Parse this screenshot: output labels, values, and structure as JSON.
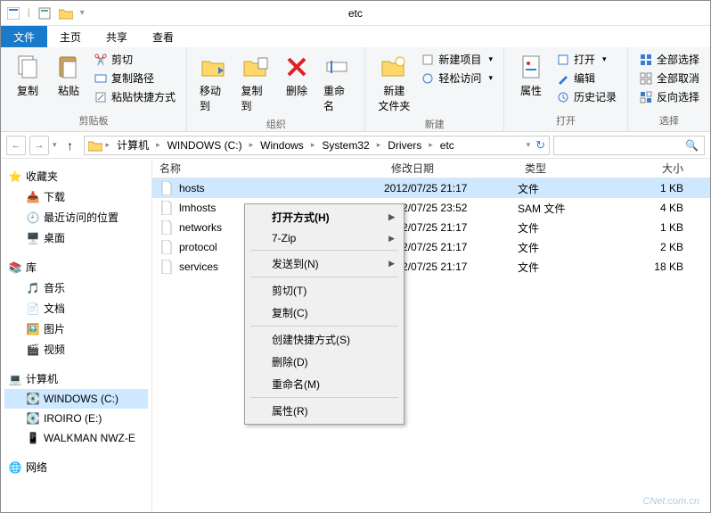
{
  "window": {
    "title": "etc"
  },
  "tabs": [
    {
      "label": "文件",
      "active": true
    },
    {
      "label": "主页",
      "active": false
    },
    {
      "label": "共享",
      "active": false
    },
    {
      "label": "查看",
      "active": false
    }
  ],
  "ribbon": {
    "clipboard": {
      "label": "剪贴板",
      "copy": "复制",
      "paste": "粘贴",
      "cut": "剪切",
      "copy_path": "复制路径",
      "paste_shortcut": "粘贴快捷方式"
    },
    "organize": {
      "label": "组织",
      "move_to": "移动到",
      "copy_to": "复制到",
      "delete": "删除",
      "rename": "重命名"
    },
    "new": {
      "label": "新建",
      "new_folder": "新建\n文件夹",
      "new_item": "新建项目",
      "easy_access": "轻松访问"
    },
    "open": {
      "label": "打开",
      "properties": "属性",
      "open": "打开",
      "edit": "编辑",
      "history": "历史记录"
    },
    "select": {
      "label": "选择",
      "select_all": "全部选择",
      "select_none": "全部取消",
      "invert": "反向选择"
    }
  },
  "breadcrumbs": [
    "计算机",
    "WINDOWS (C:)",
    "Windows",
    "System32",
    "Drivers",
    "etc"
  ],
  "columns": {
    "name": "名称",
    "date": "修改日期",
    "type": "类型",
    "size": "大小"
  },
  "files": [
    {
      "name": "hosts",
      "date": "2012/07/25 21:17",
      "type": "文件",
      "size": "1 KB",
      "selected": true
    },
    {
      "name": "lmhosts",
      "date": "2012/07/25 23:52",
      "type": "SAM 文件",
      "size": "4 KB",
      "selected": false
    },
    {
      "name": "networks",
      "date": "2012/07/25 21:17",
      "type": "文件",
      "size": "1 KB",
      "selected": false
    },
    {
      "name": "protocol",
      "date": "2012/07/25 21:17",
      "type": "文件",
      "size": "2 KB",
      "selected": false
    },
    {
      "name": "services",
      "date": "2012/07/25 21:17",
      "type": "文件",
      "size": "18 KB",
      "selected": false
    }
  ],
  "sidebar": {
    "favorites": {
      "label": "收藏夹",
      "items": [
        "下载",
        "最近访问的位置",
        "桌面"
      ]
    },
    "libraries": {
      "label": "库",
      "items": [
        "音乐",
        "文档",
        "图片",
        "视频"
      ]
    },
    "computer": {
      "label": "计算机",
      "items": [
        "WINDOWS (C:)",
        "IROIRO (E:)",
        "WALKMAN NWZ-E"
      ]
    },
    "network": {
      "label": "网络"
    }
  },
  "context_menu": [
    {
      "label": "打开方式(H)",
      "bold": true,
      "sub": true
    },
    {
      "label": "7-Zip",
      "sub": true
    },
    {
      "sep": true
    },
    {
      "label": "发送到(N)",
      "sub": true
    },
    {
      "sep": true
    },
    {
      "label": "剪切(T)"
    },
    {
      "label": "复制(C)"
    },
    {
      "sep": true
    },
    {
      "label": "创建快捷方式(S)"
    },
    {
      "label": "删除(D)",
      "shield": true
    },
    {
      "label": "重命名(M)",
      "shield": true
    },
    {
      "sep": true
    },
    {
      "label": "属性(R)"
    }
  ],
  "watermark": "CNet.com.cn"
}
